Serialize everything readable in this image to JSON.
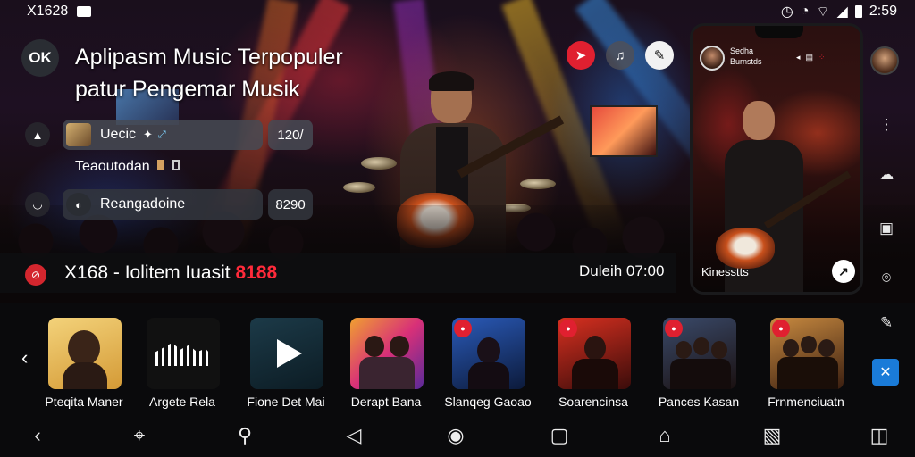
{
  "status": {
    "time_left": "X1628",
    "time_right": "2:59"
  },
  "header": {
    "avatar_text": "OK",
    "title": "Aplipasm Music Terpopuler patur Pengemar Musik"
  },
  "rows": [
    {
      "label": "Uecic",
      "count": "120/"
    },
    {
      "label": "Reangadoine",
      "count": "8290"
    }
  ],
  "subtitle": "Teaoutodan",
  "now_playing": {
    "prefix": "X168 - Iolitem Iuasit",
    "highlight": "8188",
    "right": "Duleih 07:00"
  },
  "phone": {
    "header_line1": "Sedha",
    "header_line2": "Burnstds",
    "caption": "Kinesstts"
  },
  "cards": [
    {
      "label": "Pteqita Maner"
    },
    {
      "label": "Argete Rela"
    },
    {
      "label": "Fione Det Mai"
    },
    {
      "label": "Derapt Bana"
    },
    {
      "label": "Slanqeg Gaoao"
    },
    {
      "label": "Soarencinsa"
    },
    {
      "label": "Pances Kasan"
    },
    {
      "label": "Frnmenciuatn"
    }
  ],
  "colors": {
    "accent": "#e02030",
    "blue": "#1a7bd8"
  }
}
